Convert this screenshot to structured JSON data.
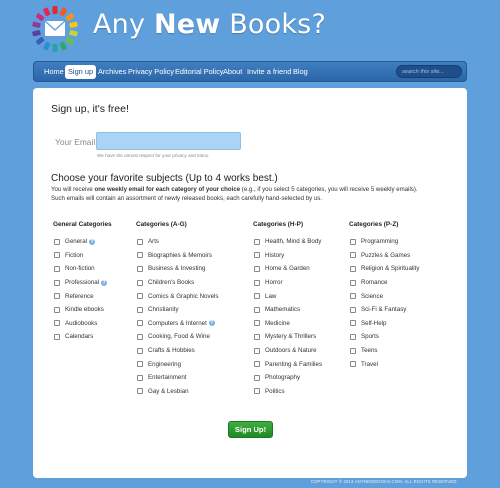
{
  "brand": {
    "name_plain_1": "Any ",
    "name_bold": "New",
    "name_plain_2": " Books?"
  },
  "nav": {
    "items": [
      "Home",
      "Sign up",
      "Archives",
      "Privacy Policy",
      "Editorial Policy",
      "About",
      "Invite a friend",
      "Blog"
    ],
    "active": "Sign up",
    "search_placeholder": "search this site..."
  },
  "signup": {
    "title": "Sign up, it's free!",
    "email_label": "Your Email",
    "email_value": "",
    "privacy_note": "We have the utmost respect for your privacy and inbox.",
    "subjects_title": "Choose your favorite subjects (Up to 4 works best.)",
    "desc_line1_pre": "You will receive ",
    "desc_line1_bold": "one weekly email for each category of your choice",
    "desc_line1_post": " (e.g., if you select 5 categories, you will receive 5 weekly emails).",
    "desc_line2": "Such emails will contain an assortment of newly released books, each carefully hand-selected by us.",
    "button_label": "Sign Up!"
  },
  "categories": [
    {
      "title": "General Categories",
      "items": [
        "General",
        "Fiction",
        "Non-fiction",
        "Professional",
        "Reference",
        "Kindle ebooks",
        "Audiobooks",
        "Calendars"
      ],
      "help": [
        "General",
        "Professional"
      ]
    },
    {
      "title": "Categories (A-G)",
      "items": [
        "Arts",
        "Biographies & Memoirs",
        "Business & Investing",
        "Children's Books",
        "Comics & Graphic Novels",
        "Christianity",
        "Computers & Internet",
        "Cooking, Food & Wine",
        "Crafts & Hobbies",
        "Engineering",
        "Entertainment",
        "Gay & Lesbian"
      ],
      "help": [
        "Computers & Internet"
      ]
    },
    {
      "title": "Categories (H-P)",
      "items": [
        "Health, Mind & Body",
        "History",
        "Home & Garden",
        "Horror",
        "Law",
        "Mathematics",
        "Medicine",
        "Mystery & Thrillers",
        "Outdoors & Nature",
        "Parenting & Families",
        "Photography",
        "Politics"
      ],
      "help": []
    },
    {
      "title": "Categories (P-Z)",
      "items": [
        "Programming",
        "Puzzles & Games",
        "Religion & Spirituality",
        "Romance",
        "Science",
        "Sci-Fi & Fantasy",
        "Self-Help",
        "Sports",
        "Teens",
        "Travel"
      ],
      "help": []
    }
  ],
  "footer": "COPYRIGHT © 2013 ANYNEWBOOKS.COM. ALL RIGHTS RESERVED.",
  "colors": {
    "background": "#5fa0dc",
    "nav": "#2c66a8",
    "button": "#2a9a31",
    "input": "#aad3f5"
  }
}
